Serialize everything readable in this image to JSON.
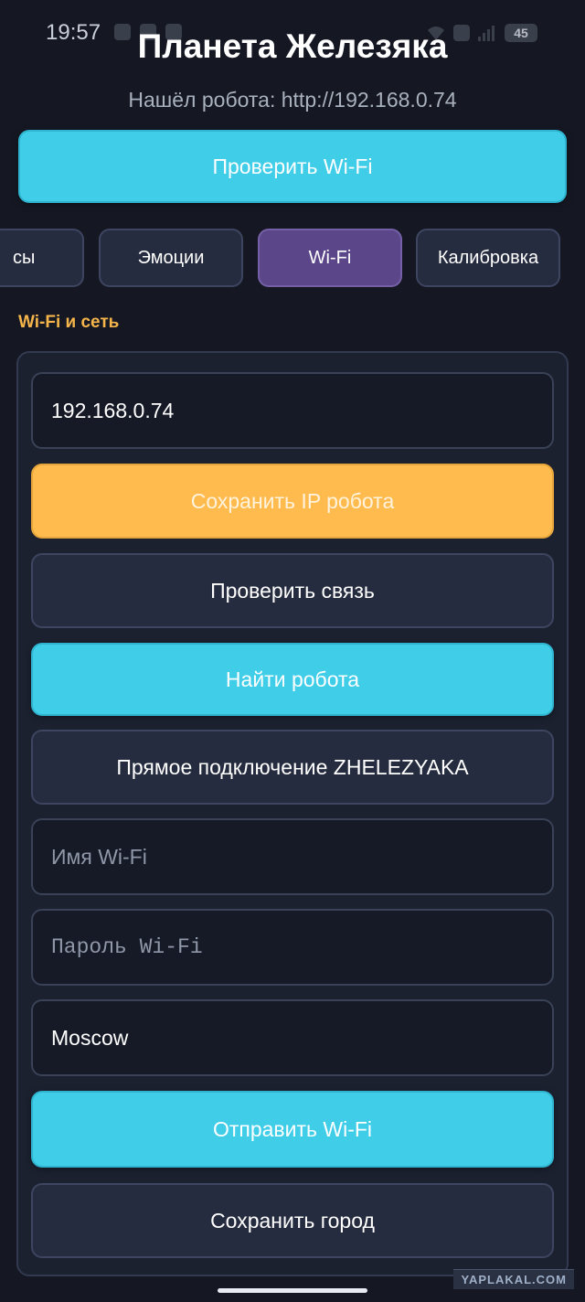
{
  "status_bar": {
    "time": "19:57",
    "battery": "45"
  },
  "header": {
    "title": "Планета Железяка",
    "robot_status": "Нашёл робота: http://192.168.0.74"
  },
  "check_wifi_button": "Проверить Wi-Fi",
  "tabs": [
    {
      "label": "сы",
      "active": false
    },
    {
      "label": "Эмоции",
      "active": false
    },
    {
      "label": "Wi-Fi",
      "active": true
    },
    {
      "label": "Калибровка",
      "active": false
    }
  ],
  "section": {
    "title": "Wi-Fi и сеть"
  },
  "form": {
    "ip_field": {
      "value": "192.168.0.74",
      "placeholder": ""
    },
    "save_ip_button": "Сохранить IP робота",
    "check_connection_button": "Проверить связь",
    "find_robot_button": "Найти робота",
    "direct_connect_button": "Прямое подключение ZHELEZYAKA",
    "wifi_name_field": {
      "value": "",
      "placeholder": "Имя Wi-Fi"
    },
    "wifi_password_field": {
      "value": "",
      "placeholder": "Пароль Wi-Fi"
    },
    "city_field": {
      "value": "Moscow",
      "placeholder": ""
    },
    "send_wifi_button": "Отправить Wi-Fi",
    "save_city_button": "Сохранить город"
  },
  "watermark": "YAPLAKAL.COM",
  "colors": {
    "background": "#151823",
    "accent_cyan": "#3fcde8",
    "accent_orange": "#ffbb4d",
    "tab_active": "#5a4688",
    "section_title": "#f5b54a"
  }
}
